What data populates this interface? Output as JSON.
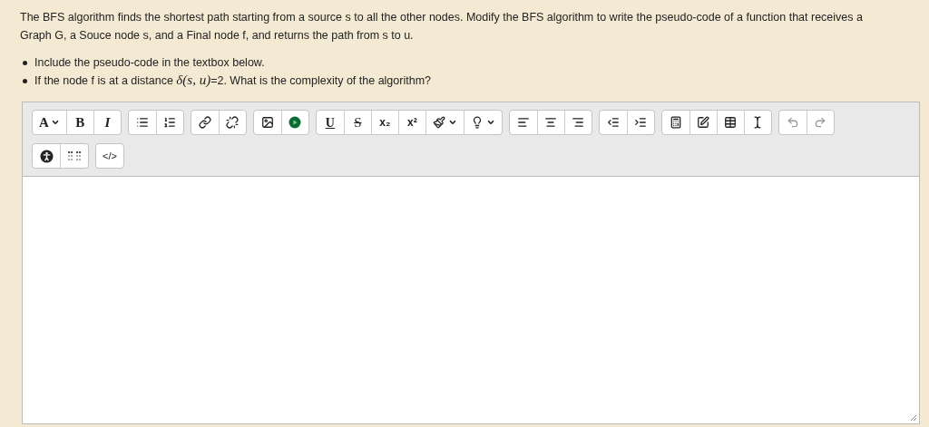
{
  "question": {
    "text": "The BFS algorithm finds the shortest path starting from a source s to all the other nodes. Modify the BFS algorithm to write the pseudo-code of a function that receives a Graph G, a Souce node s, and a Final node f, and returns the path from s to u.",
    "bullets": [
      {
        "before": "Include the pseudo-code in the textbox below."
      },
      {
        "before": "If the node f is at a distance ",
        "math": "δ(s, u)",
        "after": "=2. What is the complexity of the algorithm?"
      }
    ]
  },
  "toolbar": [
    [
      [
        {
          "kind": "font",
          "label": "A"
        },
        {
          "kind": "bold",
          "label": "B"
        },
        {
          "kind": "italic",
          "label": "I"
        }
      ],
      [
        {
          "kind": "bullets"
        },
        {
          "kind": "numbers"
        }
      ],
      [
        {
          "kind": "link"
        },
        {
          "kind": "unlink"
        }
      ],
      [
        {
          "kind": "image"
        },
        {
          "kind": "media"
        }
      ],
      [
        {
          "kind": "underline",
          "label": "U"
        },
        {
          "kind": "strike",
          "label": "S"
        },
        {
          "kind": "subscript",
          "label": "x₂"
        },
        {
          "kind": "superscript",
          "label": "x²"
        },
        {
          "kind": "brush"
        },
        {
          "kind": "bulb"
        }
      ],
      [
        {
          "kind": "align-left"
        },
        {
          "kind": "align-center"
        },
        {
          "kind": "align-right"
        }
      ],
      [
        {
          "kind": "outdent"
        },
        {
          "kind": "indent"
        }
      ],
      [
        {
          "kind": "calculator"
        },
        {
          "kind": "edit"
        },
        {
          "kind": "table"
        },
        {
          "kind": "cursor"
        }
      ],
      [
        {
          "kind": "undo",
          "disabled": true
        },
        {
          "kind": "redo",
          "disabled": true
        }
      ]
    ],
    [
      [
        {
          "kind": "accessibility"
        },
        {
          "kind": "braille"
        }
      ],
      [
        {
          "kind": "code",
          "label": "</>"
        }
      ]
    ]
  ]
}
